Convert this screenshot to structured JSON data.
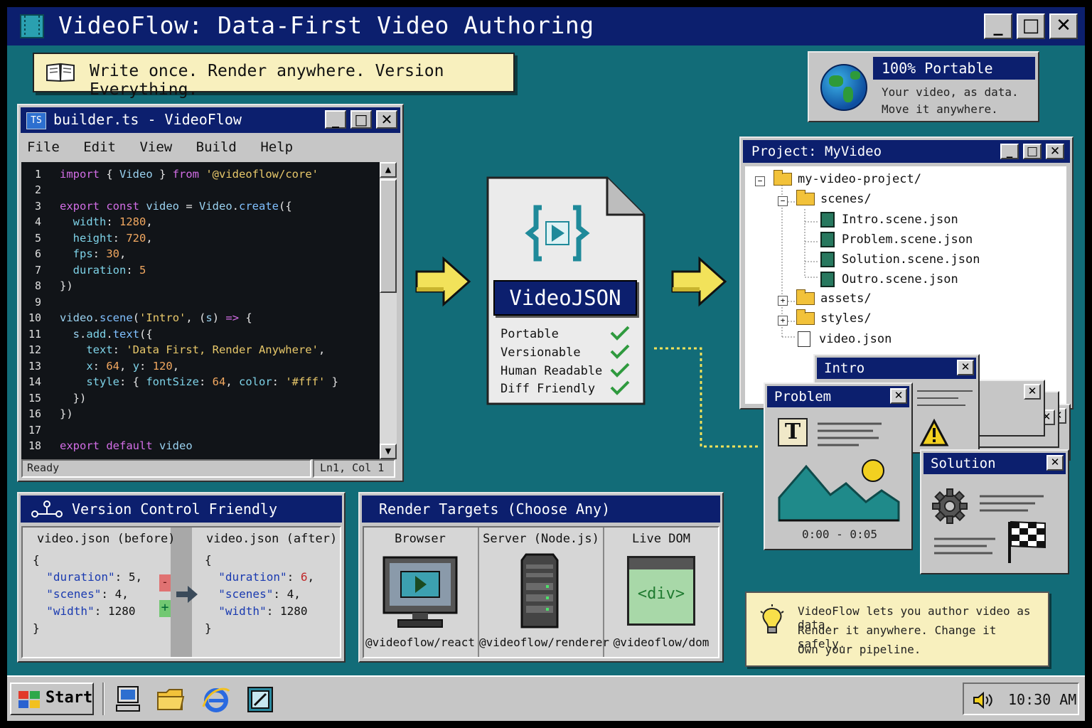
{
  "app": {
    "title": "VideoFlow: Data-First Video Authoring"
  },
  "banner": {
    "text": "Write once. Render anywhere. Version Everything."
  },
  "portable": {
    "title": "100% Portable",
    "line1": "Your video, as data.",
    "line2": "Move it anywhere."
  },
  "editor": {
    "title": "builder.ts - VideoFlow",
    "menu": [
      "File",
      "Edit",
      "View",
      "Build",
      "Help"
    ],
    "line_numbers": [
      "1",
      "2",
      "3",
      "4",
      "5",
      "6",
      "7",
      "8",
      "9",
      "10",
      "11",
      "12",
      "13",
      "14",
      "15",
      "16",
      "17",
      "18"
    ],
    "status_left": "Ready",
    "status_right": "Ln1, Col 1"
  },
  "videojson": {
    "title": "VideoJSON",
    "features": [
      "Portable",
      "Versionable",
      "Human Readable",
      "Diff Friendly"
    ]
  },
  "project": {
    "title": "Project: MyVideo",
    "root": "my-video-project/",
    "scenes_folder": "scenes/",
    "scene_files": [
      "Intro.scene.json",
      "Problem.scene.json",
      "Solution.scene.json",
      "Outro.scene.json"
    ],
    "assets_folder": "assets/",
    "styles_folder": "styles/",
    "video_file": "video.json"
  },
  "cards": {
    "intro": "Intro",
    "problem": "Problem",
    "problem_time": "0:00 - 0:05",
    "solution": "Solution"
  },
  "version_control": {
    "title": "Version Control Friendly",
    "before_label": "video.json (before)",
    "after_label": "video.json (after)",
    "before": {
      "duration": "5",
      "scenes": "4",
      "width": "1280"
    },
    "after": {
      "duration": "6",
      "scenes": "4",
      "width": "1280"
    },
    "minus": "-",
    "plus": "+"
  },
  "render_targets": {
    "title": "Render Targets (Choose Any)",
    "targets": [
      {
        "name": "Browser",
        "package": "@videoflow/react"
      },
      {
        "name": "Server (Node.js)",
        "package": "@videoflow/renderer"
      },
      {
        "name": "Live DOM",
        "package": "@videoflow/dom",
        "icon_text": "<div>"
      }
    ]
  },
  "tip": {
    "line1": "VideoFlow lets you author video as data.",
    "line2": "Render it anywhere. Change it safely.",
    "line3": "Own your pipeline."
  },
  "taskbar": {
    "start": "Start",
    "clock": "10:30 AM"
  },
  "colors": {
    "desktop": "#126c78",
    "titlebar": "#0c1f6e",
    "window": "#c6c6c6",
    "arrow": "#f2e25a",
    "check": "#2f9a3e"
  }
}
